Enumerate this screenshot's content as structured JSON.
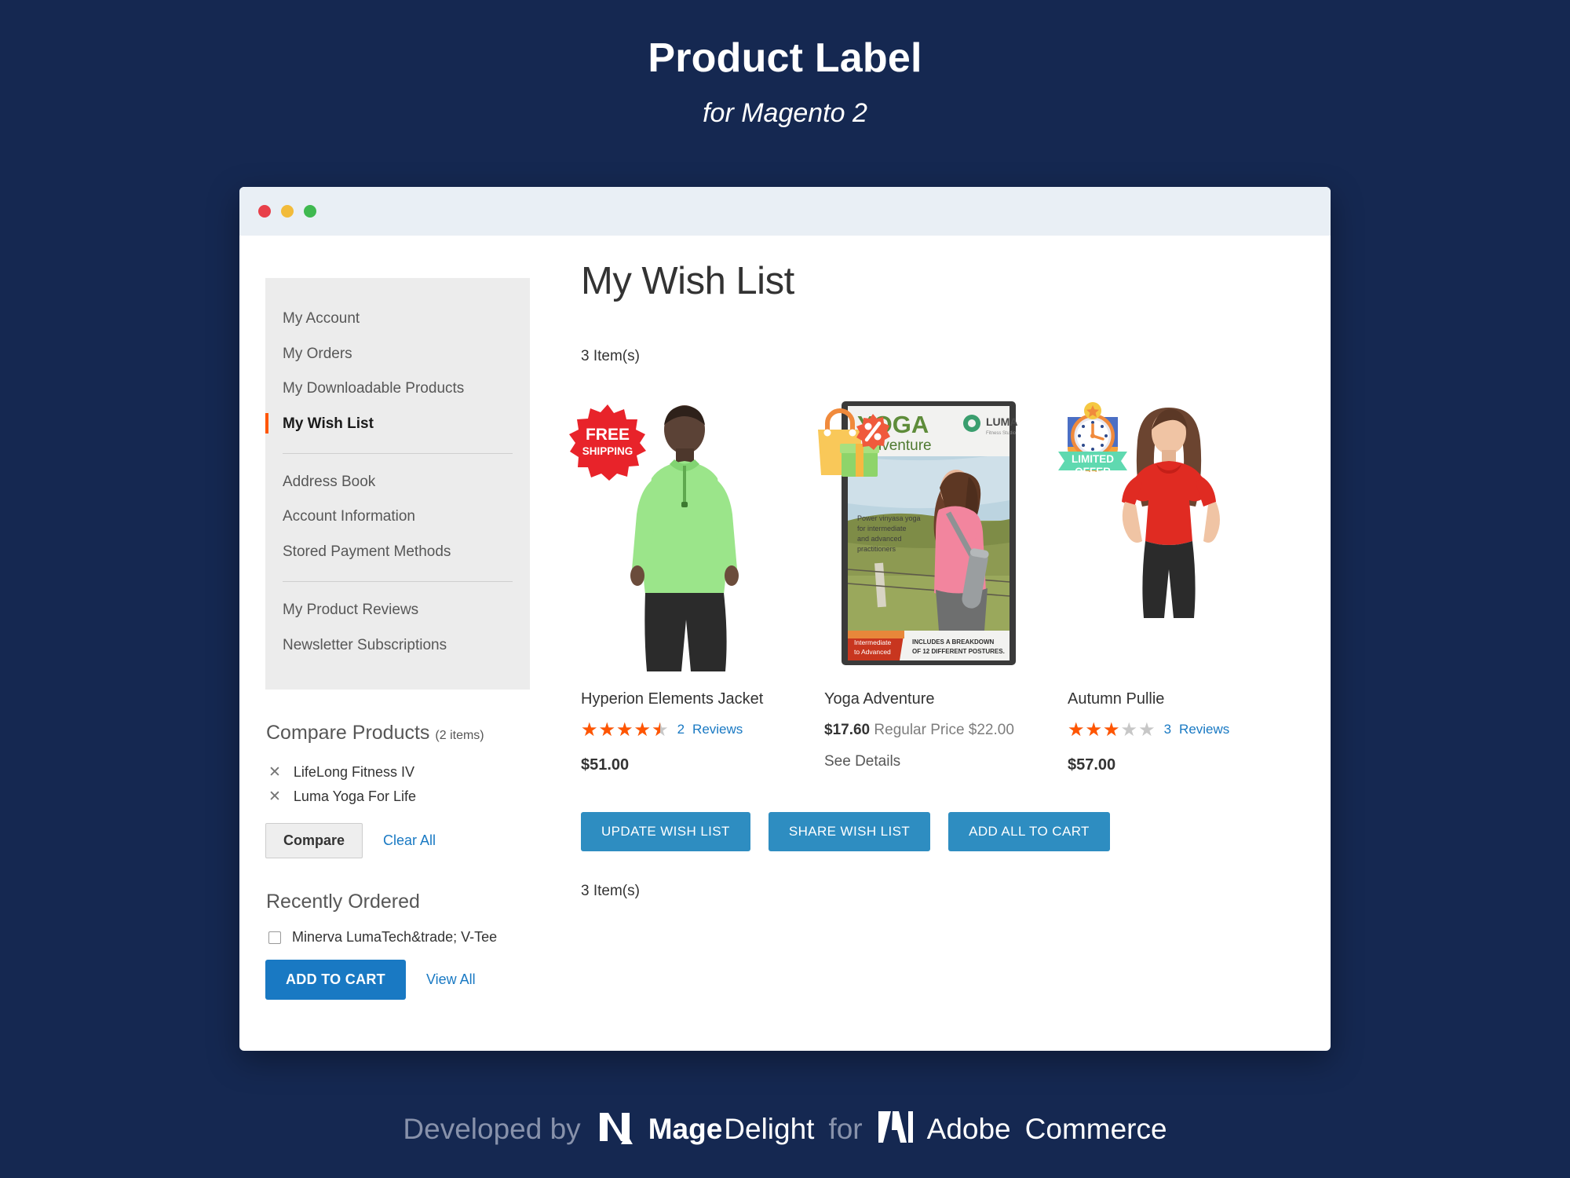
{
  "hero": {
    "title": "Product Label",
    "subtitle": "for Magento 2"
  },
  "browser": {
    "dots": [
      "close-red",
      "minimize-yellow",
      "maximize-green"
    ]
  },
  "sidebar": {
    "nav_groups": [
      {
        "items": [
          {
            "label": "My Account",
            "active": false
          },
          {
            "label": "My Orders",
            "active": false
          },
          {
            "label": "My Downloadable Products",
            "active": false
          },
          {
            "label": "My Wish List",
            "active": true
          }
        ]
      },
      {
        "items": [
          {
            "label": "Address Book",
            "active": false
          },
          {
            "label": "Account Information",
            "active": false
          },
          {
            "label": "Stored Payment Methods",
            "active": false
          }
        ]
      },
      {
        "items": [
          {
            "label": "My Product Reviews",
            "active": false
          },
          {
            "label": "Newsletter Subscriptions",
            "active": false
          }
        ]
      }
    ],
    "compare": {
      "heading": "Compare Products",
      "count": "(2 items)",
      "items": [
        {
          "label": "LifeLong Fitness IV"
        },
        {
          "label": "Luma Yoga For Life"
        }
      ],
      "compare_button": "Compare",
      "clear_all": "Clear All"
    },
    "recently_ordered": {
      "heading": "Recently Ordered",
      "items": [
        {
          "label": "Minerva LumaTech&trade; V-Tee",
          "checked": false
        }
      ],
      "add_to_cart": "ADD TO CART",
      "view_all": "View All"
    }
  },
  "main": {
    "page_title": "My Wish List",
    "item_count_top": "3 Item(s)",
    "item_count_bottom": "3 Item(s)",
    "products": [
      {
        "name": "Hyperion Elements Jacket",
        "rating": 4.5,
        "review_count": "2",
        "review_label": "Reviews",
        "price": "$51.00",
        "has_special": false,
        "badge": {
          "type": "free-shipping",
          "line1": "FREE",
          "line2": "SHIPPING",
          "color": "#e8232a"
        }
      },
      {
        "name": "Yoga Adventure",
        "rating": 0,
        "review_count": "",
        "review_label": "",
        "special_price": "$17.60",
        "regular_label": "Regular Price",
        "regular_price": "$22.00",
        "has_special": true,
        "see_details": "See Details",
        "cover": {
          "title_top": "YOGA",
          "title_bottom": "Adventure",
          "brand": "LUMA",
          "brand_sub": "Fitness Studio",
          "blurb": "Power vinyasa yoga for intermediate and advanced practitioners",
          "tag": "Intermediate to Advanced",
          "footnote": "INCLUDES A BREAKDOWN OF 12 DIFFERENT POSTURES."
        },
        "badge": {
          "type": "gift-discount",
          "color": "#f5c242"
        }
      },
      {
        "name": "Autumn Pullie",
        "rating": 3,
        "review_count": "3",
        "review_label": "Reviews",
        "price": "$57.00",
        "has_special": false,
        "badge": {
          "type": "limited-offer",
          "line1": "LIMITED",
          "line2": "OFFER",
          "color": "#4b6fc4"
        }
      }
    ],
    "actions": [
      {
        "label": "UPDATE WISH LIST"
      },
      {
        "label": "SHARE WISH LIST"
      },
      {
        "label": "ADD ALL TO CART"
      }
    ]
  },
  "footer": {
    "developed_by": "Developed by",
    "mage": "Mage",
    "delight": "Delight",
    "for": "for",
    "adobe": "Adobe",
    "commerce": "Commerce"
  },
  "colors": {
    "background": "#152851",
    "accent_orange": "#ff5501",
    "link_blue": "#1979c3",
    "button_blue": "#2e8dc1",
    "sidebar_bg": "#ececec"
  }
}
